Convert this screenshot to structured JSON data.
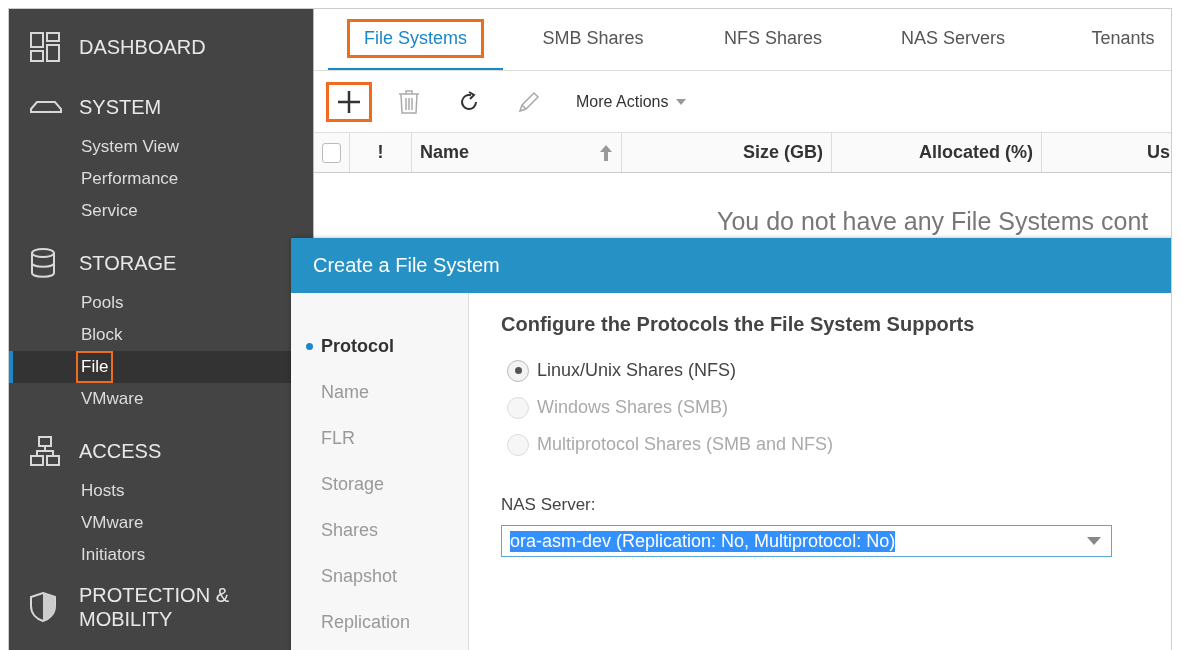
{
  "sidebar": {
    "sections": [
      {
        "label": "DASHBOARD"
      },
      {
        "label": "SYSTEM",
        "items": [
          {
            "label": "System View",
            "selected": false,
            "highlighted": false
          },
          {
            "label": "Performance",
            "selected": false,
            "highlighted": false
          },
          {
            "label": "Service",
            "selected": false,
            "highlighted": false
          }
        ]
      },
      {
        "label": "STORAGE",
        "items": [
          {
            "label": "Pools",
            "selected": false,
            "highlighted": false
          },
          {
            "label": "Block",
            "selected": false,
            "highlighted": false
          },
          {
            "label": "File",
            "selected": true,
            "highlighted": true
          },
          {
            "label": "VMware",
            "selected": false,
            "highlighted": false
          }
        ]
      },
      {
        "label": "ACCESS",
        "items": [
          {
            "label": "Hosts",
            "selected": false,
            "highlighted": false
          },
          {
            "label": "VMware",
            "selected": false,
            "highlighted": false
          },
          {
            "label": "Initiators",
            "selected": false,
            "highlighted": false
          }
        ]
      },
      {
        "label": "PROTECTION & MOBILITY"
      }
    ]
  },
  "tabs": [
    {
      "label": "File Systems",
      "selected": true,
      "highlighted": true
    },
    {
      "label": "SMB Shares",
      "selected": false,
      "highlighted": false
    },
    {
      "label": "NFS Shares",
      "selected": false,
      "highlighted": false
    },
    {
      "label": "NAS Servers",
      "selected": false,
      "highlighted": false
    },
    {
      "label": "Tenants",
      "selected": false,
      "highlighted": false
    }
  ],
  "toolbar": {
    "buttons": [
      {
        "kind": "add",
        "disabled": false,
        "highlighted": true
      },
      {
        "kind": "delete",
        "disabled": true,
        "highlighted": false
      },
      {
        "kind": "refresh",
        "disabled": false,
        "highlighted": false
      },
      {
        "kind": "edit",
        "disabled": true,
        "highlighted": false
      }
    ],
    "menu": "More Actions"
  },
  "table": {
    "select_all": {
      "checked": false
    },
    "columns": [
      {
        "label": "!"
      },
      {
        "label": "Name",
        "sorted": true
      },
      {
        "label": "Size (GB)"
      },
      {
        "label": "Allocated (%)"
      },
      {
        "label": "Us"
      }
    ],
    "empty_message": "You do not have any File Systems cont"
  },
  "dialog": {
    "title": "Create a File System",
    "steps": [
      {
        "label": "Protocol",
        "selected": true
      },
      {
        "label": "Name",
        "selected": false
      },
      {
        "label": "FLR",
        "selected": false
      },
      {
        "label": "Storage",
        "selected": false
      },
      {
        "label": "Shares",
        "selected": false
      },
      {
        "label": "Snapshot",
        "selected": false
      },
      {
        "label": "Replication",
        "selected": false
      }
    ],
    "heading": "Configure the Protocols the File System Supports",
    "options": [
      {
        "label": "Linux/Unix Shares (NFS)",
        "selected": true,
        "disabled": false
      },
      {
        "label": "Windows Shares (SMB)",
        "selected": false,
        "disabled": true
      },
      {
        "label": "Multiprotocol Shares (SMB and NFS)",
        "selected": false,
        "disabled": true
      }
    ],
    "nas_server": {
      "label": "NAS Server:",
      "value": "ora-asm-dev (Replication: No, Multiprotocol: No)",
      "text_selected": true
    }
  }
}
